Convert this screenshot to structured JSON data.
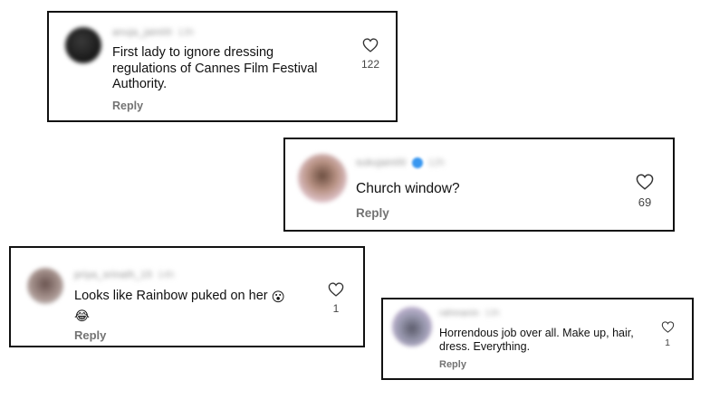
{
  "comments": [
    {
      "username": "anuja_jain00",
      "time": "13h",
      "text": "First lady to ignore dressing regulations of Cannes Film Festival Authority.",
      "likes": "122",
      "reply_label": "Reply",
      "avatar_color": "#1e1e1e"
    },
    {
      "username": "sukujain00",
      "time": "12h",
      "verified": true,
      "text": "Church window?",
      "likes": "69",
      "reply_label": "Reply",
      "avatar_color": "#c9a99a"
    },
    {
      "username": "priya_srinath_15",
      "time": "14h",
      "text": "Looks like Rainbow puked on her",
      "emoji_1": "😮",
      "emoji_2": "😂",
      "likes": "1",
      "reply_label": "Reply",
      "avatar_color": "#8a7a78"
    },
    {
      "username": "rahmanin",
      "time": "13h",
      "text": "Horrendous job over all. Make up, hair, dress. Everything.",
      "likes": "1",
      "reply_label": "Reply",
      "avatar_color": "#a48fb8"
    }
  ],
  "icons": {
    "like": "heart-outline-icon"
  }
}
